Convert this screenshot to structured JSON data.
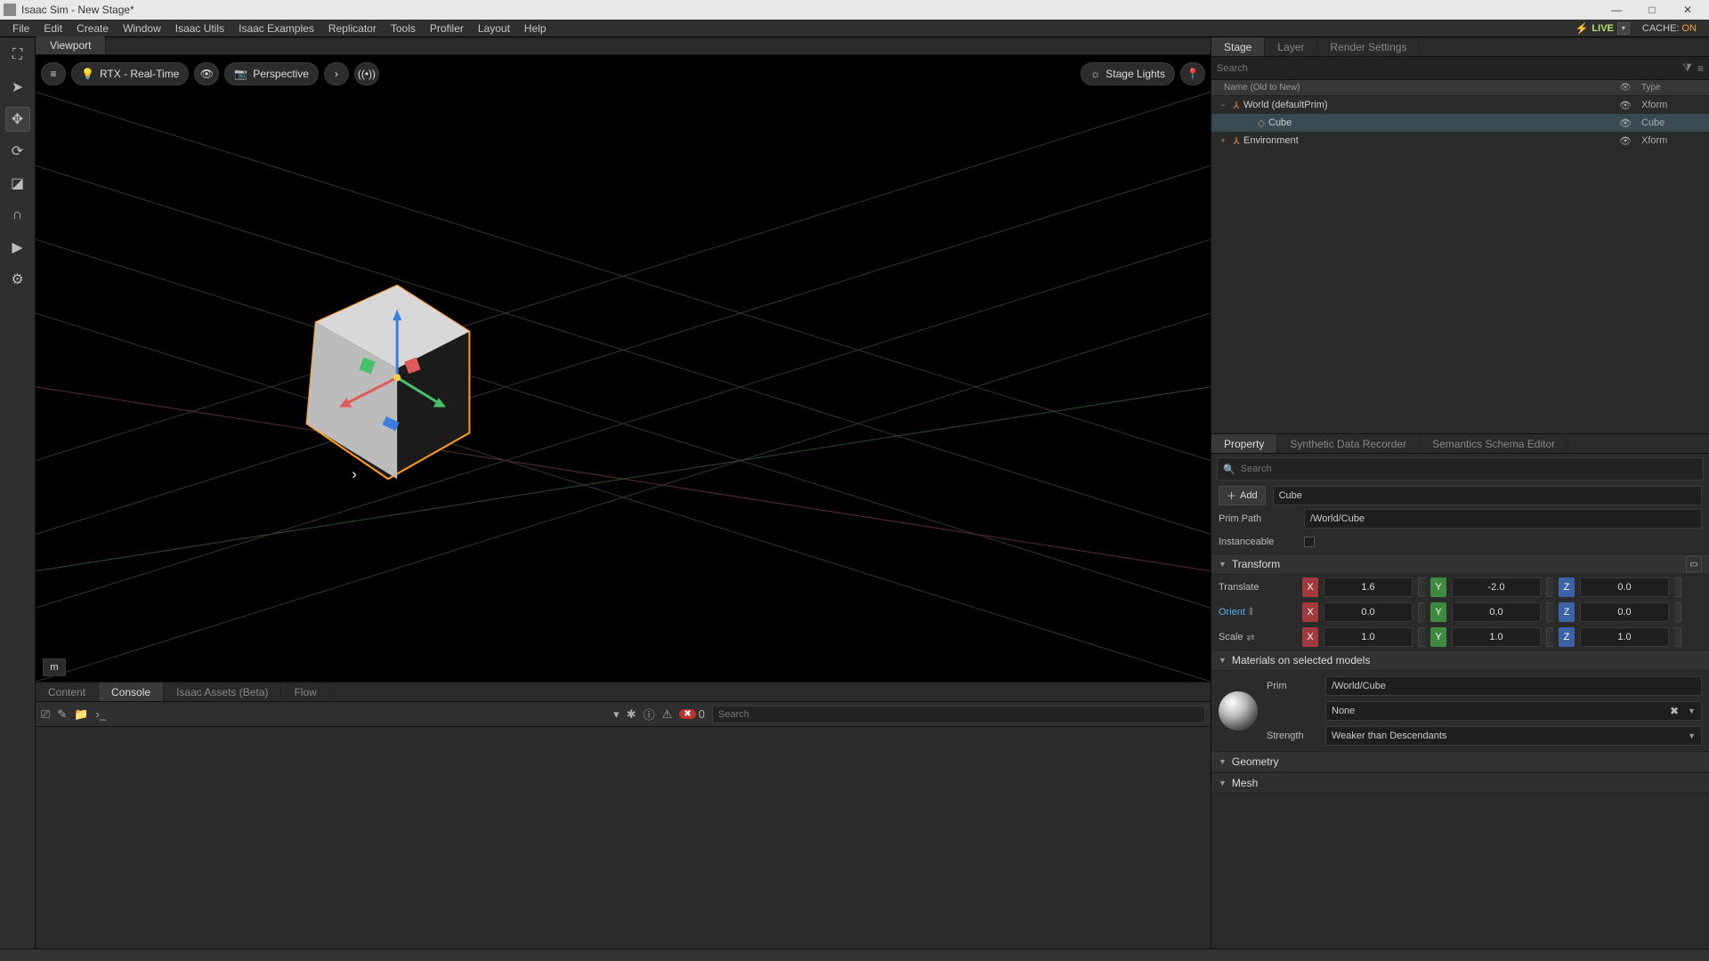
{
  "title": "Isaac Sim   - New Stage*",
  "window_buttons": {
    "min": "—",
    "max": "□",
    "close": "✕"
  },
  "menu": [
    "File",
    "Edit",
    "Create",
    "Window",
    "Isaac Utils",
    "Isaac Examples",
    "Replicator",
    "Tools",
    "Profiler",
    "Layout",
    "Help"
  ],
  "live": {
    "label": "LIVE",
    "cache_label": "CACHE:",
    "cache_state": "ON"
  },
  "viewport": {
    "tab": "Viewport",
    "renderer": "RTX - Real-Time",
    "camera": "Perspective",
    "stage_lights": "Stage Lights",
    "unit": "m"
  },
  "bottom_tabs": [
    "Content",
    "Console",
    "Isaac Assets (Beta)",
    "Flow"
  ],
  "bottom_active": 1,
  "console": {
    "error_count": "0",
    "search_placeholder": "Search"
  },
  "stage": {
    "tabs": [
      "Stage",
      "Layer",
      "Render Settings"
    ],
    "active": 0,
    "search_placeholder": "Search",
    "header_name": "Name (Old to New)",
    "header_type": "Type",
    "rows": [
      {
        "indent": 1,
        "exp": "−",
        "name": "World (defaultPrim)",
        "type": "Xform",
        "selected": false,
        "icon_color": "#e58b46"
      },
      {
        "indent": 2,
        "exp": "",
        "name": "Cube",
        "type": "Cube",
        "selected": true,
        "icon_color": "#888"
      },
      {
        "indent": 1,
        "exp": "+",
        "name": "Environment",
        "type": "Xform",
        "selected": false,
        "icon_color": "#e58b46"
      }
    ]
  },
  "prop_tabs": [
    "Property",
    "Synthetic Data Recorder",
    "Semantics Schema Editor"
  ],
  "prop_active": 0,
  "property": {
    "search_placeholder": "Search",
    "add_label": "Add",
    "name_value": "Cube",
    "prim_path_label": "Prim Path",
    "prim_path_value": "/World/Cube",
    "instanceable_label": "Instanceable",
    "transform_title": "Transform",
    "translate_label": "Translate",
    "orient_label": "Orient",
    "scale_label": "Scale",
    "translate": {
      "x": "1.6",
      "y": "-2.0",
      "z": "0.0"
    },
    "orient": {
      "x": "0.0",
      "y": "0.0",
      "z": "0.0"
    },
    "scale": {
      "x": "1.0",
      "y": "1.0",
      "z": "1.0"
    },
    "materials_title": "Materials on selected models",
    "mat_prim_label": "Prim",
    "mat_prim_value": "/World/Cube",
    "mat_value": "None",
    "strength_label": "Strength",
    "strength_value": "Weaker than Descendants",
    "geometry_title": "Geometry",
    "mesh_title": "Mesh"
  }
}
